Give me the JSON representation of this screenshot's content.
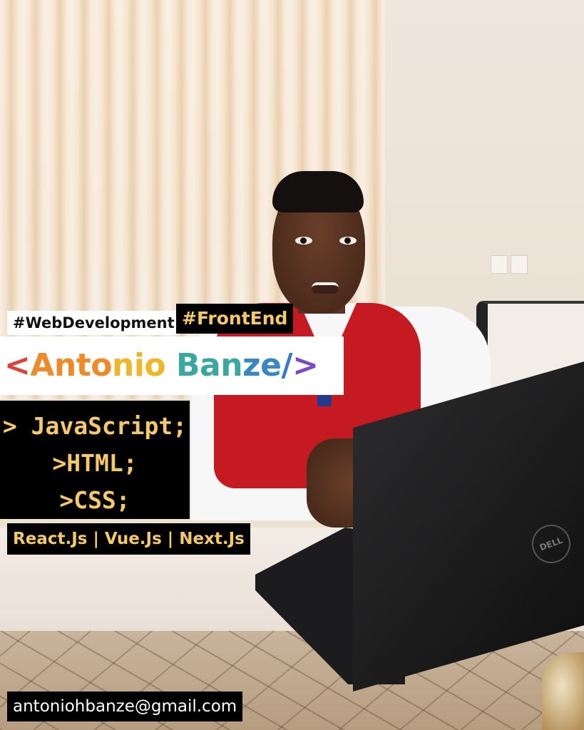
{
  "hashtags": {
    "web_development": "#WebDevelopment",
    "front_end": "#FrontEnd"
  },
  "name_tag": {
    "open": "<",
    "name_parts": [
      "Anto",
      "nio ",
      "Ban",
      "ze",
      "/"
    ],
    "close": ">"
  },
  "skills": {
    "line1": "> JavaScript;",
    "line2": ">HTML;",
    "line3": ">CSS;"
  },
  "frameworks": "React.Js | Vue.Js | Next.Js",
  "email": "antoniohbanze@gmail.com",
  "laptop_logo": "DELL",
  "colors": {
    "accent_yellow": "#f5c96a",
    "vest_red": "#c51a22",
    "name_gradient": [
      "#e0403a",
      "#ef8a2a",
      "#f0b62a",
      "#3aa8a0",
      "#3a78c8",
      "#7a4ac8"
    ]
  }
}
